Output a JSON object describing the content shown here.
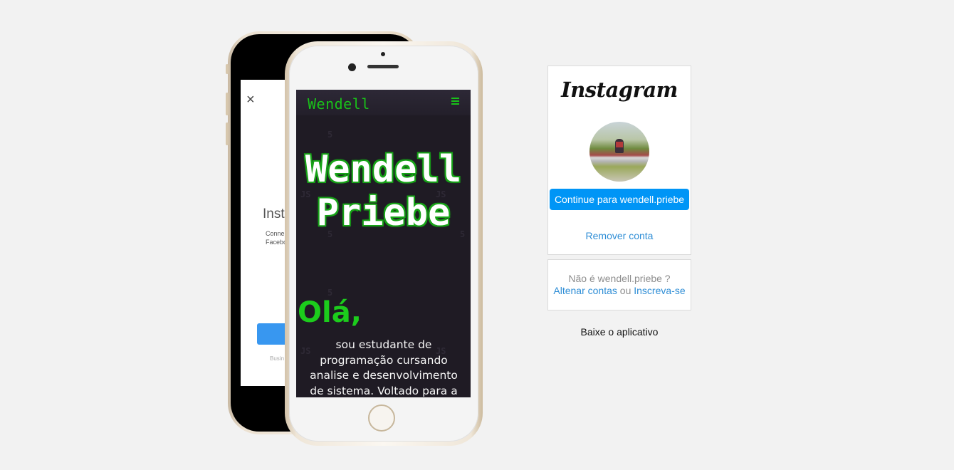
{
  "back_phone": {
    "title": "Insta",
    "text_line1": "Conne",
    "text_line2": "Facebo",
    "footer": "Busin",
    "close_icon": "×"
  },
  "front_phone": {
    "site_logo": "Wendell",
    "hero_line1": "Wendell",
    "hero_line2": "Priebe",
    "greeting": "Olá,",
    "intro_text": "sou estudante de programação cursando analise e desenvolvimento de sistema. Voltado para a área",
    "menu_icon": "hamburger-menu-icon",
    "accent_color": "#19c219"
  },
  "login": {
    "logo": "Instagram",
    "continue_button": "Continue para wendell.priebe",
    "remove_account": "Remover conta",
    "not_user": "Não é wendell.priebe ?",
    "switch_accounts": "Altenar contas",
    "or": "ou",
    "signup": "Inscreva-se",
    "download_app": "Baixe o aplicativo",
    "button_color": "#0095f6",
    "link_color": "#2f8ed6"
  }
}
